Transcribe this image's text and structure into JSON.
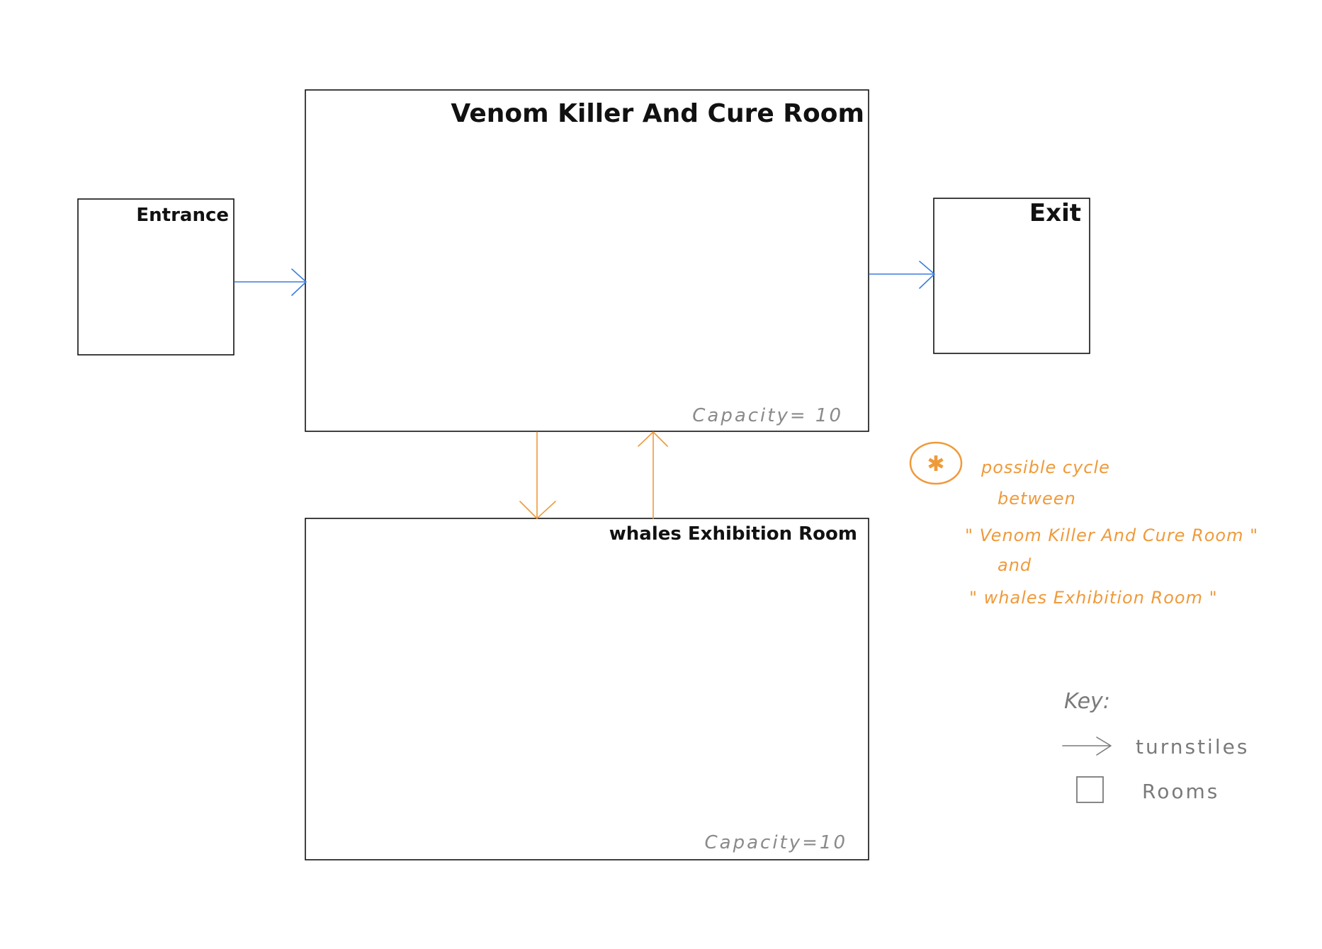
{
  "colors": {
    "room_outline": "#111111",
    "turnstile_entrance_exit": "#3b7de0",
    "turnstile_between_rooms": "#ef9a3a",
    "capacity_text": "#8a8a8a",
    "note": "#ef9a3a",
    "key": "#7a7a7a"
  },
  "rooms": {
    "entrance": {
      "title": "Entrance"
    },
    "venom": {
      "title": "Venom Killer And Cure Room",
      "capacity": "Capacity= 10"
    },
    "exit": {
      "title": "Exit"
    },
    "whales": {
      "title": "whales Exhibition Room",
      "capacity": "Capacity=10"
    }
  },
  "note": {
    "mark": "✱",
    "line1": "possible cycle",
    "line2": "between",
    "line3": "\" Venom Killer And Cure Room \"",
    "line4": "and",
    "line5": "\" whales Exhibition Room \""
  },
  "key": {
    "title": "Key:",
    "turnstiles": "turnstiles",
    "rooms": "Rooms"
  },
  "icons": {
    "note_marker": "circled-asterisk-icon",
    "turnstile_symbol": "arrow-right-icon",
    "room_symbol": "square-icon"
  }
}
